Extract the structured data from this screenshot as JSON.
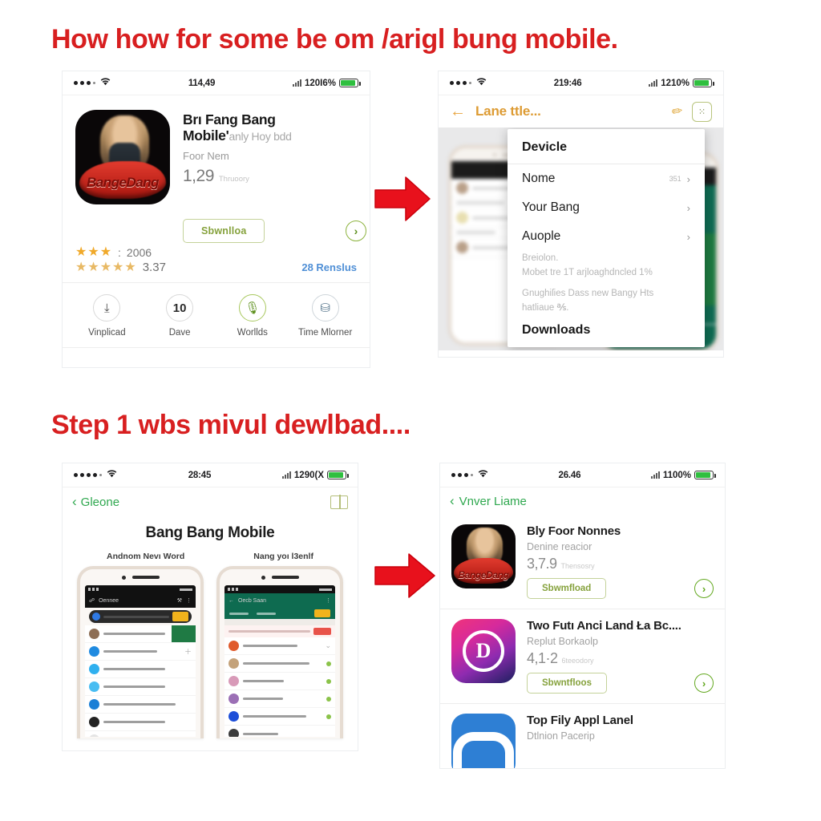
{
  "headings": {
    "first": "How how for some be om /arigl bung mobile.",
    "second": "Step 1 wbs mivul dewlbad....",
    "color": "#d81f20"
  },
  "arrows": {
    "first_name": "red-right-arrow",
    "second_name": "red-right-arrow",
    "color": "#e8111c"
  },
  "panel_top_left": {
    "status_bar": {
      "time": "114,49",
      "battery": "120I6%"
    },
    "app": {
      "title_line1": "Brı Fang Bang",
      "title_line2": "Mobile'",
      "title_faint": "anly Hoy bdd",
      "subtitle": "Foor Nem",
      "price": "1,29",
      "price_note": "Thruoory",
      "download_label": "Sbwnlloa",
      "go_icon": "chevron-right-circle-icon",
      "rating_count": "2006",
      "rating_score": "3.37",
      "reviews_link": "28 Renslus",
      "stars_top": "★★★",
      "stars_bottom": "★★★★★"
    },
    "actions": [
      {
        "icon": "download-stamp-icon",
        "badge": "",
        "label": "Vinplicad"
      },
      {
        "icon": "number-badge-icon",
        "badge": "10",
        "label": "Dave"
      },
      {
        "icon": "microphone-icon",
        "badge": "",
        "label": "Worllds"
      },
      {
        "icon": "gift-box-icon",
        "badge": "",
        "label": "Time Mlorner"
      }
    ]
  },
  "panel_top_right": {
    "status_bar": {
      "time": "219:46",
      "battery": "1210%"
    },
    "nav": {
      "back_icon": "arrow-left-icon",
      "title": "Lane ttle...",
      "pencil_icon": "pencil-icon",
      "scan_icon": "qr-scan-icon"
    },
    "dropdown": {
      "header": "Devicle",
      "items": [
        {
          "label": "Nome",
          "meta": "351",
          "chevron": "›"
        },
        {
          "label": "Your Bang",
          "meta": "",
          "chevron": "›"
        },
        {
          "label": "Auople",
          "meta": "",
          "chevron": "›"
        }
      ],
      "note_1": "Breiolon.",
      "note_2": "Mobet tre 1T arjloaghdncled 1%",
      "note_3": "Gnughiſies Dass new Bangy Hts",
      "note_4": "hatliaue ℁.",
      "footer": "Downloads"
    }
  },
  "panel_bottom_left": {
    "status_bar": {
      "time": "28:45",
      "battery": "1290(X"
    },
    "nav": {
      "back_icon": "chevron-left-icon",
      "back_label": "Gleone",
      "book_icon": "book-icon"
    },
    "title": "Bang Bang Mobile",
    "captions": [
      "Andnom Nevı Word",
      "Nang yoı l3enlf"
    ]
  },
  "panel_bottom_right": {
    "status_bar": {
      "time": "26.46",
      "battery": "1100%"
    },
    "nav": {
      "back_icon": "chevron-left-icon",
      "back_label": "Vnver Liame"
    },
    "apps": [
      {
        "icon": "bang-bang-app-icon",
        "icon_style": "dark",
        "logo_text": "BangeDang",
        "name": "Bly Foor Nonnes",
        "desc": "Denine reacior",
        "score": "3,7.9",
        "score_note": "Thensosry",
        "download_label": "Sbwmfload",
        "go_icon": "chevron-right-circle-icon"
      },
      {
        "icon": "pink-circle-app-icon",
        "icon_style": "pink",
        "logo_text": "D",
        "name": "Two Futı Anci Land Ła Bc....",
        "desc": "Replut Borkaolp",
        "score": "4,1·2",
        "score_note": "6teeodory",
        "download_label": "Sbwntfloos",
        "go_icon": "chevron-right-circle-icon"
      },
      {
        "icon": "blue-arch-app-icon",
        "icon_style": "blue",
        "logo_text": "",
        "name": "Top Fily Appl Lanel",
        "desc": "Dtlnion Pacerip",
        "score": "",
        "score_note": "",
        "download_label": "",
        "go_icon": ""
      }
    ]
  }
}
